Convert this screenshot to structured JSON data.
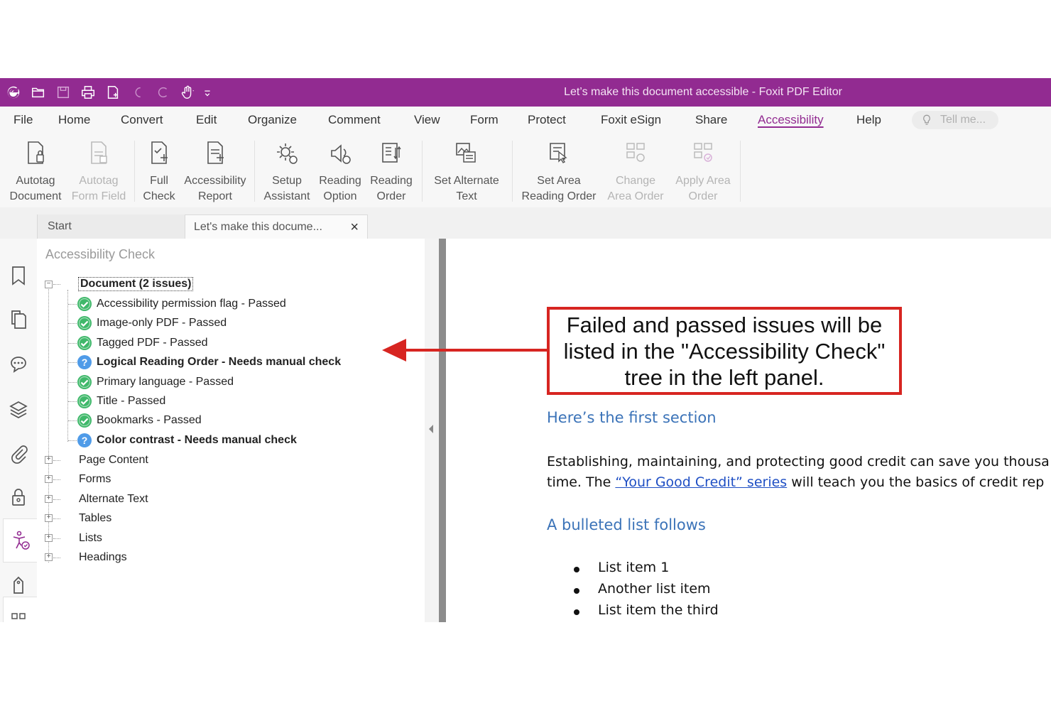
{
  "window": {
    "title": "Let’s make this document accessible - Foxit PDF Editor"
  },
  "qat_icons": [
    "foxit-logo-icon",
    "open-folder-icon",
    "save-icon",
    "print-icon",
    "new-document-icon",
    "undo-icon",
    "redo-icon",
    "hand-tool-icon",
    "customize-qat-icon"
  ],
  "menu": {
    "items": [
      "File",
      "Home",
      "Convert",
      "Edit",
      "Organize",
      "Comment",
      "View",
      "Form",
      "Protect",
      "Foxit eSign",
      "Share",
      "Accessibility",
      "Help"
    ],
    "active": "Accessibility",
    "tellme_placeholder": "Tell me..."
  },
  "ribbon": {
    "buttons": [
      {
        "label": "Autotag\nDocument",
        "icon": "autotag-document-icon",
        "enabled": true
      },
      {
        "label": "Autotag\nForm Field",
        "icon": "autotag-form-field-icon",
        "enabled": false
      },
      {
        "label": "Full\nCheck",
        "icon": "full-check-icon",
        "enabled": true
      },
      {
        "label": "Accessibility\nReport",
        "icon": "accessibility-report-icon",
        "enabled": true
      },
      {
        "label": "Setup\nAssistant",
        "icon": "setup-assistant-icon",
        "enabled": true
      },
      {
        "label": "Reading\nOption",
        "icon": "reading-option-icon",
        "enabled": true
      },
      {
        "label": "Reading\nOrder",
        "icon": "reading-order-icon",
        "enabled": true
      },
      {
        "label": "Set Alternate\nText",
        "icon": "set-alternate-text-icon",
        "enabled": true
      },
      {
        "label": "Set Area\nReading Order",
        "icon": "set-area-reading-order-icon",
        "enabled": true
      },
      {
        "label": "Change\nArea Order",
        "icon": "change-area-order-icon",
        "enabled": false
      },
      {
        "label": "Apply Area\nOrder",
        "icon": "apply-area-order-icon",
        "enabled": false
      }
    ]
  },
  "tabs": {
    "start": "Start",
    "document": "Let's make this docume...",
    "close": "×"
  },
  "rail_icons": [
    "bookmark-icon",
    "pages-icon",
    "comments-icon",
    "layers-icon",
    "attachments-icon",
    "security-icon",
    "accessibility-icon",
    "tags-icon",
    "more-panels-icon"
  ],
  "panel": {
    "title": "Accessibility Check",
    "root": "Document (2 issues)",
    "checks": [
      {
        "label": "Accessibility permission flag - Passed",
        "status": "passed"
      },
      {
        "label": "Image-only PDF - Passed",
        "status": "passed"
      },
      {
        "label": "Tagged PDF - Passed",
        "status": "passed"
      },
      {
        "label": "Logical Reading Order - Needs manual check",
        "status": "manual"
      },
      {
        "label": "Primary language - Passed",
        "status": "passed"
      },
      {
        "label": "Title - Passed",
        "status": "passed"
      },
      {
        "label": "Bookmarks - Passed",
        "status": "passed"
      },
      {
        "label": "Color contrast - Needs manual check",
        "status": "manual"
      }
    ],
    "categories": [
      "Page Content",
      "Forms",
      "Alternate Text",
      "Tables",
      "Lists",
      "Headings"
    ],
    "colors": {
      "passed": "#3fb86a",
      "manual": "#4f9be8"
    }
  },
  "document": {
    "callout": "Failed and passed issues will be listed in the \"Accessibility Check\" tree in the left panel.",
    "heading1": "Here’s the first section",
    "para_line1": "Establishing, maintaining, and protecting good credit can save you thousa",
    "para_line2_pre": "time. The ",
    "para_link": "“Your Good Credit” series",
    "para_line2_post": " will teach you the basics of credit rep",
    "heading2": "A bulleted list follows",
    "bullets": [
      "List item 1",
      "Another list item",
      "List item the third"
    ]
  },
  "colors": {
    "brand": "#922b91",
    "callout_border": "#d72521",
    "heading": "#3b73b8",
    "link": "#1f4fc4"
  }
}
